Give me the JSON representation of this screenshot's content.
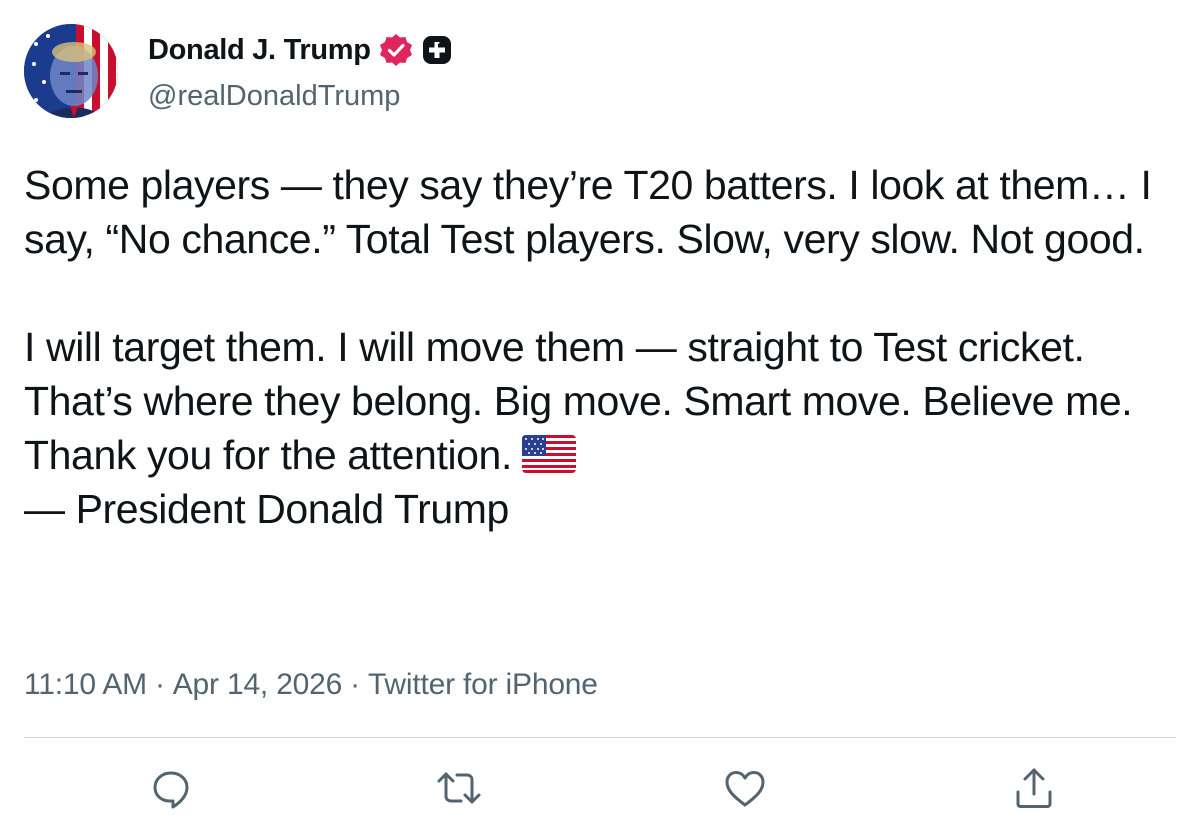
{
  "user": {
    "display_name": "Donald J. Trump",
    "handle": "@realDonaldTrump",
    "verified": true,
    "avatar": "flag-portrait-avatar"
  },
  "tweet": {
    "paragraph_1": "Some players — they say they’re T20 batters. I look at them… I say, “No chance.” Total Test players. Slow, very slow. Not good.",
    "paragraph_2_lines": [
      "I will target them. I will move them — straight to Test cricket. That’s where they belong. Big move. Smart move. Believe me.",
      "Thank you for the attention.",
      "— President Donald Trump"
    ],
    "emoji": "us-flag-emoji"
  },
  "meta": {
    "time": "11:10 AM",
    "date": "Apr 14, 2026",
    "source": "Twitter for iPhone",
    "separator": "·"
  },
  "actions": {
    "icons": [
      "reply-icon",
      "retweet-icon",
      "like-icon",
      "share-icon"
    ]
  },
  "colors": {
    "text": "#0f1419",
    "secondary": "#536471",
    "verified_badge": "#e0245e",
    "divider": "#cfd9de"
  }
}
